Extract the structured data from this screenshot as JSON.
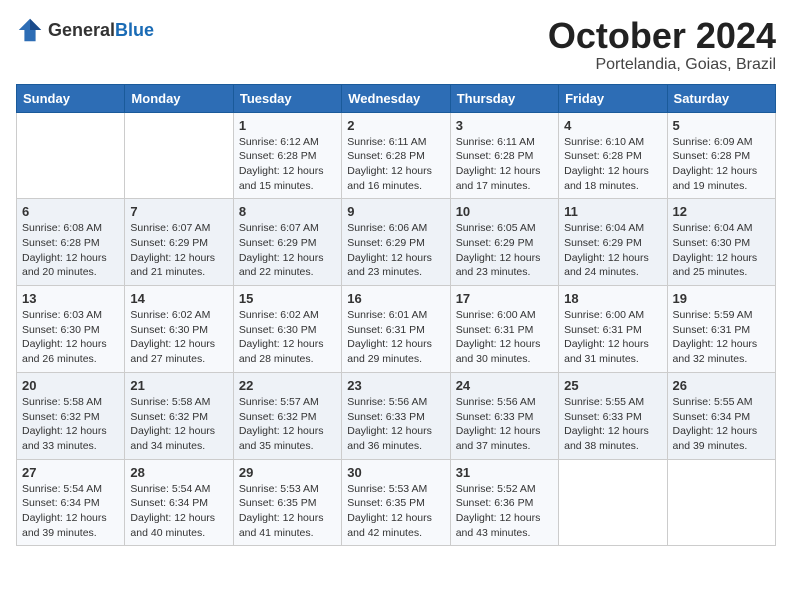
{
  "header": {
    "logo_general": "General",
    "logo_blue": "Blue",
    "month_year": "October 2024",
    "location": "Portelandia, Goias, Brazil"
  },
  "days_of_week": [
    "Sunday",
    "Monday",
    "Tuesday",
    "Wednesday",
    "Thursday",
    "Friday",
    "Saturday"
  ],
  "weeks": [
    [
      {
        "day": "",
        "sunrise": "",
        "sunset": "",
        "daylight": "",
        "empty": true
      },
      {
        "day": "",
        "sunrise": "",
        "sunset": "",
        "daylight": "",
        "empty": true
      },
      {
        "day": "1",
        "sunrise": "Sunrise: 6:12 AM",
        "sunset": "Sunset: 6:28 PM",
        "daylight": "Daylight: 12 hours and 15 minutes."
      },
      {
        "day": "2",
        "sunrise": "Sunrise: 6:11 AM",
        "sunset": "Sunset: 6:28 PM",
        "daylight": "Daylight: 12 hours and 16 minutes."
      },
      {
        "day": "3",
        "sunrise": "Sunrise: 6:11 AM",
        "sunset": "Sunset: 6:28 PM",
        "daylight": "Daylight: 12 hours and 17 minutes."
      },
      {
        "day": "4",
        "sunrise": "Sunrise: 6:10 AM",
        "sunset": "Sunset: 6:28 PM",
        "daylight": "Daylight: 12 hours and 18 minutes."
      },
      {
        "day": "5",
        "sunrise": "Sunrise: 6:09 AM",
        "sunset": "Sunset: 6:28 PM",
        "daylight": "Daylight: 12 hours and 19 minutes."
      }
    ],
    [
      {
        "day": "6",
        "sunrise": "Sunrise: 6:08 AM",
        "sunset": "Sunset: 6:28 PM",
        "daylight": "Daylight: 12 hours and 20 minutes."
      },
      {
        "day": "7",
        "sunrise": "Sunrise: 6:07 AM",
        "sunset": "Sunset: 6:29 PM",
        "daylight": "Daylight: 12 hours and 21 minutes."
      },
      {
        "day": "8",
        "sunrise": "Sunrise: 6:07 AM",
        "sunset": "Sunset: 6:29 PM",
        "daylight": "Daylight: 12 hours and 22 minutes."
      },
      {
        "day": "9",
        "sunrise": "Sunrise: 6:06 AM",
        "sunset": "Sunset: 6:29 PM",
        "daylight": "Daylight: 12 hours and 23 minutes."
      },
      {
        "day": "10",
        "sunrise": "Sunrise: 6:05 AM",
        "sunset": "Sunset: 6:29 PM",
        "daylight": "Daylight: 12 hours and 23 minutes."
      },
      {
        "day": "11",
        "sunrise": "Sunrise: 6:04 AM",
        "sunset": "Sunset: 6:29 PM",
        "daylight": "Daylight: 12 hours and 24 minutes."
      },
      {
        "day": "12",
        "sunrise": "Sunrise: 6:04 AM",
        "sunset": "Sunset: 6:30 PM",
        "daylight": "Daylight: 12 hours and 25 minutes."
      }
    ],
    [
      {
        "day": "13",
        "sunrise": "Sunrise: 6:03 AM",
        "sunset": "Sunset: 6:30 PM",
        "daylight": "Daylight: 12 hours and 26 minutes."
      },
      {
        "day": "14",
        "sunrise": "Sunrise: 6:02 AM",
        "sunset": "Sunset: 6:30 PM",
        "daylight": "Daylight: 12 hours and 27 minutes."
      },
      {
        "day": "15",
        "sunrise": "Sunrise: 6:02 AM",
        "sunset": "Sunset: 6:30 PM",
        "daylight": "Daylight: 12 hours and 28 minutes."
      },
      {
        "day": "16",
        "sunrise": "Sunrise: 6:01 AM",
        "sunset": "Sunset: 6:31 PM",
        "daylight": "Daylight: 12 hours and 29 minutes."
      },
      {
        "day": "17",
        "sunrise": "Sunrise: 6:00 AM",
        "sunset": "Sunset: 6:31 PM",
        "daylight": "Daylight: 12 hours and 30 minutes."
      },
      {
        "day": "18",
        "sunrise": "Sunrise: 6:00 AM",
        "sunset": "Sunset: 6:31 PM",
        "daylight": "Daylight: 12 hours and 31 minutes."
      },
      {
        "day": "19",
        "sunrise": "Sunrise: 5:59 AM",
        "sunset": "Sunset: 6:31 PM",
        "daylight": "Daylight: 12 hours and 32 minutes."
      }
    ],
    [
      {
        "day": "20",
        "sunrise": "Sunrise: 5:58 AM",
        "sunset": "Sunset: 6:32 PM",
        "daylight": "Daylight: 12 hours and 33 minutes."
      },
      {
        "day": "21",
        "sunrise": "Sunrise: 5:58 AM",
        "sunset": "Sunset: 6:32 PM",
        "daylight": "Daylight: 12 hours and 34 minutes."
      },
      {
        "day": "22",
        "sunrise": "Sunrise: 5:57 AM",
        "sunset": "Sunset: 6:32 PM",
        "daylight": "Daylight: 12 hours and 35 minutes."
      },
      {
        "day": "23",
        "sunrise": "Sunrise: 5:56 AM",
        "sunset": "Sunset: 6:33 PM",
        "daylight": "Daylight: 12 hours and 36 minutes."
      },
      {
        "day": "24",
        "sunrise": "Sunrise: 5:56 AM",
        "sunset": "Sunset: 6:33 PM",
        "daylight": "Daylight: 12 hours and 37 minutes."
      },
      {
        "day": "25",
        "sunrise": "Sunrise: 5:55 AM",
        "sunset": "Sunset: 6:33 PM",
        "daylight": "Daylight: 12 hours and 38 minutes."
      },
      {
        "day": "26",
        "sunrise": "Sunrise: 5:55 AM",
        "sunset": "Sunset: 6:34 PM",
        "daylight": "Daylight: 12 hours and 39 minutes."
      }
    ],
    [
      {
        "day": "27",
        "sunrise": "Sunrise: 5:54 AM",
        "sunset": "Sunset: 6:34 PM",
        "daylight": "Daylight: 12 hours and 39 minutes."
      },
      {
        "day": "28",
        "sunrise": "Sunrise: 5:54 AM",
        "sunset": "Sunset: 6:34 PM",
        "daylight": "Daylight: 12 hours and 40 minutes."
      },
      {
        "day": "29",
        "sunrise": "Sunrise: 5:53 AM",
        "sunset": "Sunset: 6:35 PM",
        "daylight": "Daylight: 12 hours and 41 minutes."
      },
      {
        "day": "30",
        "sunrise": "Sunrise: 5:53 AM",
        "sunset": "Sunset: 6:35 PM",
        "daylight": "Daylight: 12 hours and 42 minutes."
      },
      {
        "day": "31",
        "sunrise": "Sunrise: 5:52 AM",
        "sunset": "Sunset: 6:36 PM",
        "daylight": "Daylight: 12 hours and 43 minutes."
      },
      {
        "day": "",
        "sunrise": "",
        "sunset": "",
        "daylight": "",
        "empty": true
      },
      {
        "day": "",
        "sunrise": "",
        "sunset": "",
        "daylight": "",
        "empty": true
      }
    ]
  ]
}
